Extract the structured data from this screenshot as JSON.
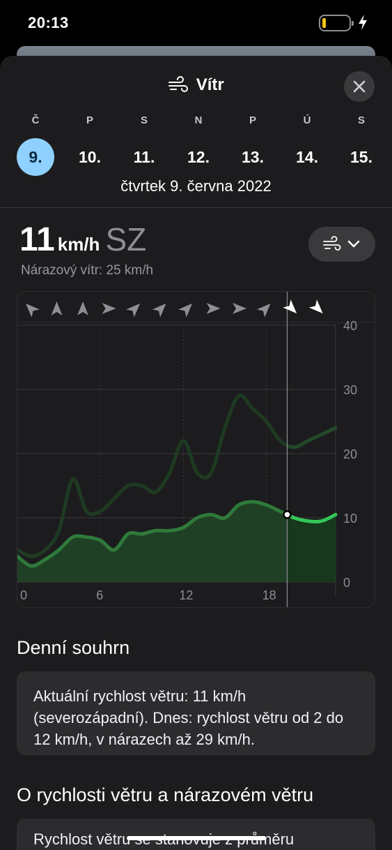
{
  "status_bar": {
    "time": "20:13",
    "battery_color": "#f5c518"
  },
  "sheet": {
    "icon": "wind-icon",
    "title": "Vítr",
    "close_icon": "close-icon"
  },
  "days": [
    {
      "letter": "Č",
      "number": "9.",
      "selected": true
    },
    {
      "letter": "P",
      "number": "10.",
      "selected": false
    },
    {
      "letter": "S",
      "number": "11.",
      "selected": false
    },
    {
      "letter": "N",
      "number": "12.",
      "selected": false
    },
    {
      "letter": "P",
      "number": "13.",
      "selected": false
    },
    {
      "letter": "Ú",
      "number": "14.",
      "selected": false
    },
    {
      "letter": "S",
      "number": "15.",
      "selected": false
    }
  ],
  "selected_date": "čtvrtek 9. června 2022",
  "current": {
    "speed": "11",
    "unit": "km/h",
    "direction": "SZ",
    "gust_text": "Nárazový vítr: 25 km/h"
  },
  "chart_data": {
    "type": "line",
    "x_ticks": [
      "0",
      "6",
      "12",
      "18"
    ],
    "y_ticks": [
      "0",
      "10",
      "20",
      "30",
      "40"
    ],
    "xlim": [
      0,
      23
    ],
    "ylim": [
      0,
      40
    ],
    "current_hour": 19.5,
    "series": [
      {
        "x": [
          0,
          1,
          2,
          3,
          4,
          5,
          6,
          7,
          8,
          9,
          10,
          11,
          12,
          13,
          14,
          15,
          16,
          17,
          18,
          19,
          20,
          21,
          22,
          23
        ],
        "values": [
          4,
          2.5,
          3.5,
          5,
          7,
          7,
          6.5,
          5,
          7.5,
          7.5,
          8,
          8,
          8.5,
          10,
          10.5,
          10,
          12,
          12.5,
          12,
          11,
          10,
          9.5,
          9.5,
          10.5
        ]
      },
      {
        "x": [
          0,
          1,
          2,
          3,
          4,
          5,
          6,
          7,
          8,
          9,
          10,
          11,
          12,
          13,
          14,
          15,
          16,
          17,
          18,
          19,
          20,
          21,
          22,
          23
        ],
        "values": [
          5,
          4,
          5,
          8,
          16,
          11,
          11,
          13,
          15,
          15,
          14,
          17,
          22,
          17,
          17,
          24,
          29,
          27,
          25,
          22,
          21,
          22,
          23,
          24
        ]
      }
    ],
    "direction_arrows": [
      {
        "hour": 0,
        "rotation": 315
      },
      {
        "hour": 2,
        "rotation": 0
      },
      {
        "hour": 4,
        "rotation": 0
      },
      {
        "hour": 6,
        "rotation": 90
      },
      {
        "hour": 8,
        "rotation": 45
      },
      {
        "hour": 10,
        "rotation": 45
      },
      {
        "hour": 12,
        "rotation": 45
      },
      {
        "hour": 14,
        "rotation": 90
      },
      {
        "hour": 16,
        "rotation": 90
      },
      {
        "hour": 18,
        "rotation": 45
      },
      {
        "hour": 20,
        "rotation": 135
      },
      {
        "hour": 22,
        "rotation": 135
      }
    ],
    "colors": {
      "speed": "#34c759",
      "gust": "#23492a"
    }
  },
  "summary": {
    "title": "Denní souhrn",
    "text": "Aktuální rychlost větru: 11 km/h (severozápadní). Dnes: rychlost větru od 2 do 12 km/h, v nárazech až 29 km/h."
  },
  "about": {
    "title": "O rychlosti větru a nárazovém větru",
    "text": "Rychlost větru se stanovuje z průměru"
  }
}
